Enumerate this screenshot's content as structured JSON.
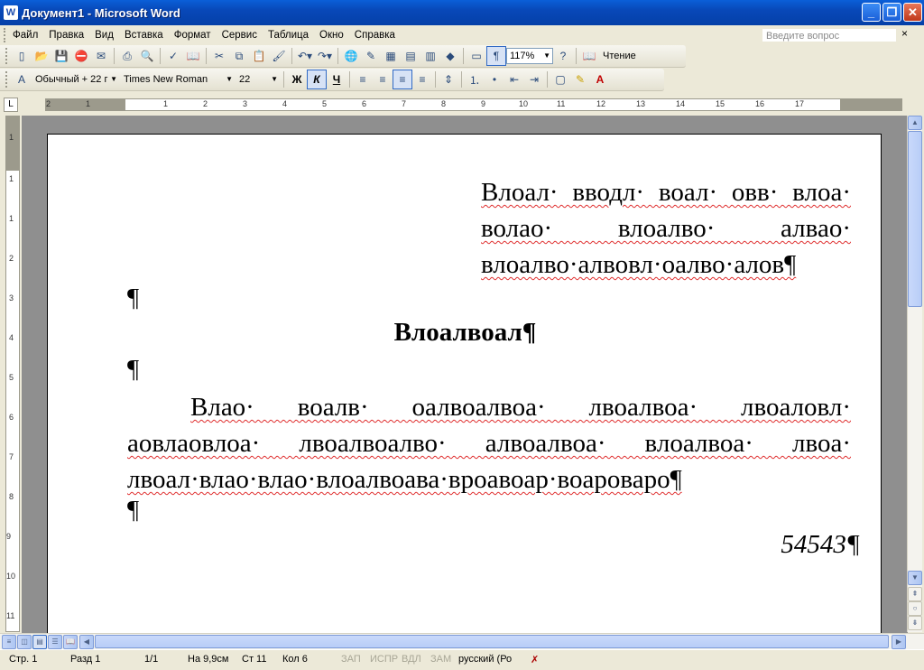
{
  "window": {
    "title": "Документ1 - Microsoft Word",
    "app_icon": "word-icon",
    "controls": [
      "_",
      "❐",
      "✕"
    ]
  },
  "menu": {
    "items": [
      "Файл",
      "Правка",
      "Вид",
      "Вставка",
      "Формат",
      "Сервис",
      "Таблица",
      "Окно",
      "Справка"
    ],
    "ask_placeholder": "Введите вопрос",
    "close": "×"
  },
  "toolbar_standard": {
    "zoom": "117%",
    "reading_label": "Чтение"
  },
  "toolbar_formatting": {
    "style": "Обычный + 22 г",
    "font": "Times New Roman",
    "size": "22",
    "bold": "Ж",
    "italic": "К",
    "underline": "Ч"
  },
  "ruler": {
    "h_numbers": [
      "2",
      "1",
      "1",
      "1",
      "2",
      "3",
      "4",
      "5",
      "6",
      "7",
      "8",
      "9",
      "10",
      "11",
      "12",
      "13",
      "14",
      "15",
      "16",
      "17"
    ],
    "v_numbers": [
      "1",
      "1",
      "1",
      "2",
      "3",
      "4",
      "5",
      "6",
      "7",
      "8",
      "9",
      "10",
      "11"
    ],
    "tab_selector": "L"
  },
  "document": {
    "para1_words": [
      "Влоал",
      "вводл",
      "воал",
      "овв",
      "влоа",
      "волао",
      "влоалво",
      "алвао",
      "влоалво",
      "алвовл",
      "оалво",
      "алов"
    ],
    "para1_lines": [
      "Влоал· вводл· воал· овв· влоа·",
      "волао·  влоалво·  алвао·",
      "влоалво·алвовл·оалво·алов¶"
    ],
    "empty1": "¶",
    "heading": "Влоалвоал¶",
    "empty2": "¶",
    "para2_lines": [
      "Влао·  воалв·  оалвоалвоа·  лвоалвоа·  лвоаловл·",
      "аовлаовлоа·  лвоалвоалво·  алвоалвоа·  влоалвоа·  лвоа·",
      "лвоал·влао·влао·влоалвоава·вроавоар·воароваро¶"
    ],
    "empty3": "¶",
    "number": "54543¶"
  },
  "status": {
    "page": "Стр. 1",
    "section": "Разд 1",
    "pages": "1/1",
    "at": "На 9,9см",
    "line": "Ст 11",
    "col": "Кол 6",
    "rec": "ЗАП",
    "trk": "ИСПР",
    "ext": "ВДЛ",
    "ovr": "ЗАМ",
    "lang": "русский (Ро"
  },
  "colors": {
    "titlebar": "#0a5fd8",
    "chrome": "#ece9d8",
    "workspace": "#8f8f8f",
    "squiggle": "#e03030"
  }
}
